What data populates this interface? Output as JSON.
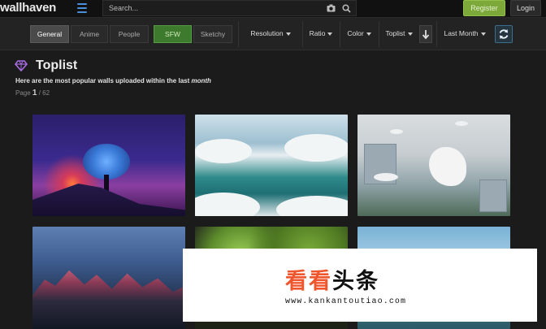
{
  "header": {
    "logo": "wallhaven",
    "search_placeholder": "Search...",
    "register_label": "Register",
    "login_label": "Login"
  },
  "filters": {
    "categories": [
      {
        "label": "General",
        "active": true
      },
      {
        "label": "Anime",
        "active": false
      },
      {
        "label": "People",
        "active": false
      }
    ],
    "purity": [
      {
        "label": "SFW",
        "active": true
      },
      {
        "label": "Sketchy",
        "active": false
      }
    ],
    "dropdowns": {
      "resolution": "Resolution",
      "ratio": "Ratio",
      "color": "Color",
      "sort": "Toplist",
      "range": "Last Month"
    }
  },
  "main": {
    "title": "Toplist",
    "subtitle_prefix": "Here are the most popular walls uploaded within the last",
    "subtitle_period": "month",
    "page_label": "Page",
    "page_current": "1",
    "page_total": "/ 62"
  },
  "thumbnails": [
    {
      "subject": "night sky with glowing tree on hill"
    },
    {
      "subject": "ocean between clouds"
    },
    {
      "subject": "girl in white dress with birds above city"
    },
    {
      "subject": "pink-lit mountain range"
    },
    {
      "subject": "avocados and lime"
    },
    {
      "subject": "sea coast under clouds"
    }
  ],
  "watermark": {
    "cn_orange": "看看",
    "cn_black": "头条",
    "url": "www.kankantoutiao.com"
  },
  "colors": {
    "accent_blue": "#4a8fd8",
    "register_green": "#7da83a",
    "sfw_green": "#3d7a2e",
    "watermark_orange": "#f0562d"
  }
}
